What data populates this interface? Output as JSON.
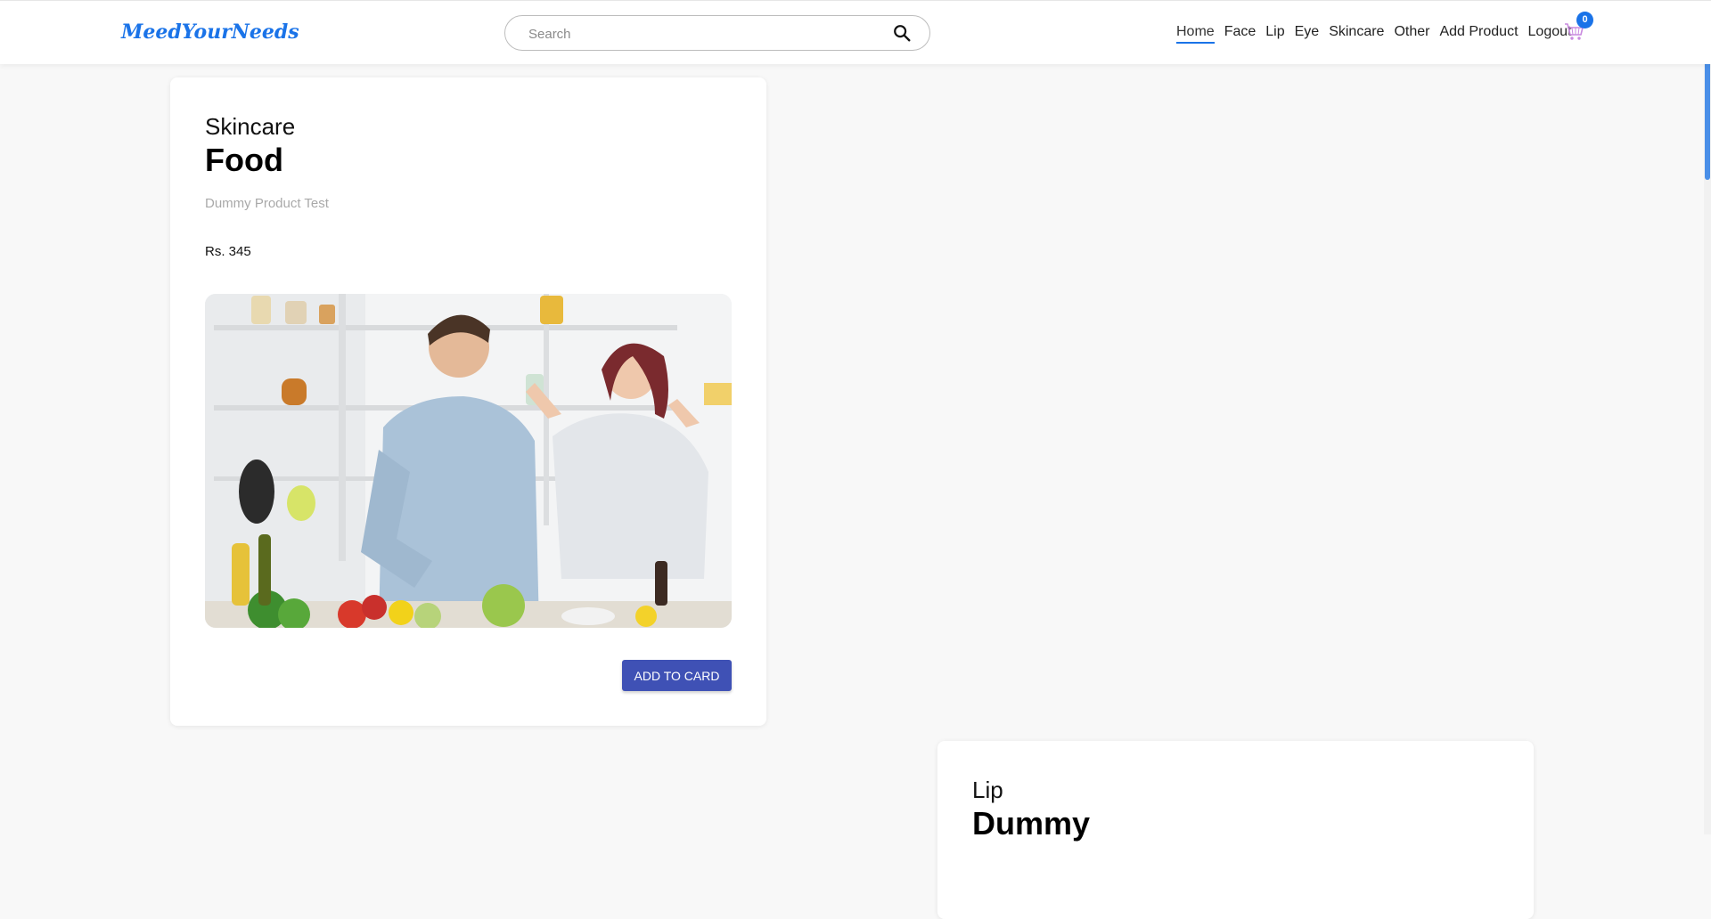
{
  "header": {
    "logo": "MeedYourNeeds",
    "search_placeholder": "Search",
    "nav": [
      "Home",
      "Face",
      "Lip",
      "Eye",
      "Skincare",
      "Other",
      "Add Product",
      "Logout"
    ],
    "cart_count": "0"
  },
  "products": [
    {
      "category": "Skincare",
      "title": "Food",
      "description": "Dummy Product Test",
      "price": "Rs. 345",
      "button": "ADD TO CARD"
    },
    {
      "category": "Lip",
      "title": "Dummy"
    }
  ],
  "colors": {
    "accent": "#1a73e8",
    "button": "#3f51b5",
    "background": "#f8f8f8"
  }
}
